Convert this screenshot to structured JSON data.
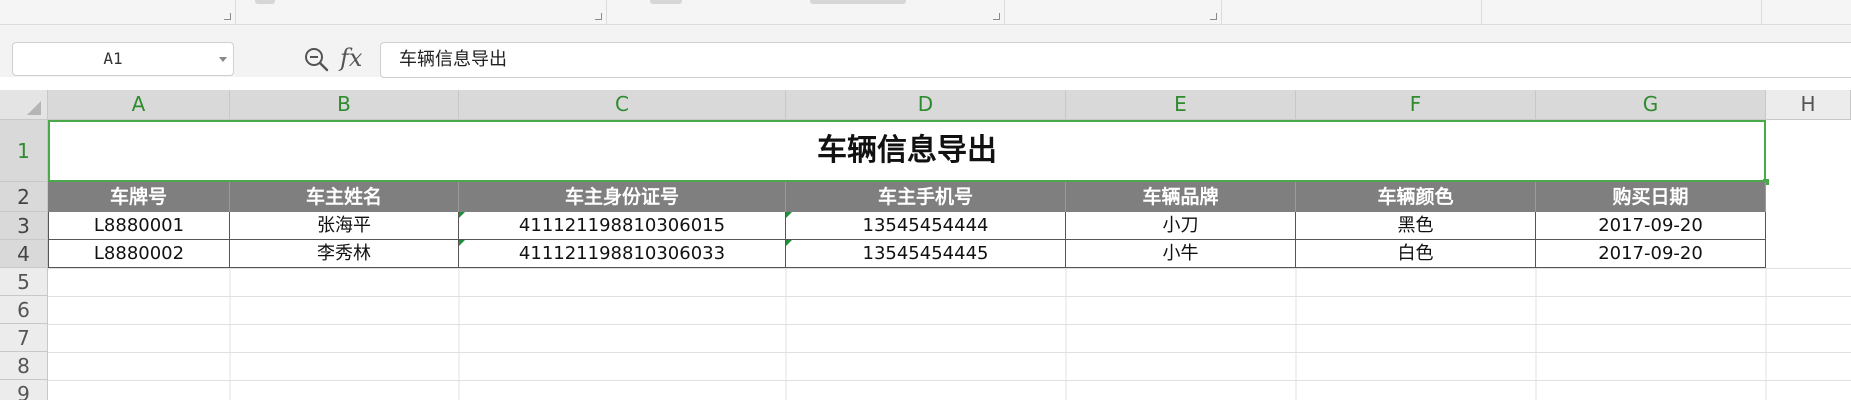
{
  "formula_bar": {
    "name_box": "A1",
    "formula": "车辆信息导出",
    "fx_label": "fx",
    "zoom_icon": "zoom-icon"
  },
  "columns": [
    "A",
    "B",
    "C",
    "D",
    "E",
    "F",
    "G",
    "H"
  ],
  "rows": [
    "1",
    "2",
    "3",
    "4",
    "5",
    "6",
    "7",
    "8",
    "9"
  ],
  "sheet": {
    "title": "车辆信息导出",
    "headers": [
      "车牌号",
      "车主姓名",
      "车主身份证号",
      "车主手机号",
      "车辆品牌",
      "车辆颜色",
      "购买日期"
    ],
    "data_rows": [
      [
        "L8880001",
        "张海平",
        "411121198810306015",
        "13545454444",
        "小刀",
        "黑色",
        "2017-09-20"
      ],
      [
        "L8880002",
        "李秀林",
        "411121198810306033",
        "13545454445",
        "小牛",
        "白色",
        "2017-09-20"
      ]
    ],
    "text_number_flag_columns": [
      2,
      3
    ]
  },
  "colors": {
    "accent": "#4aa84a",
    "header_fill": "#7f7f7f",
    "header_text": "#ffffff"
  }
}
